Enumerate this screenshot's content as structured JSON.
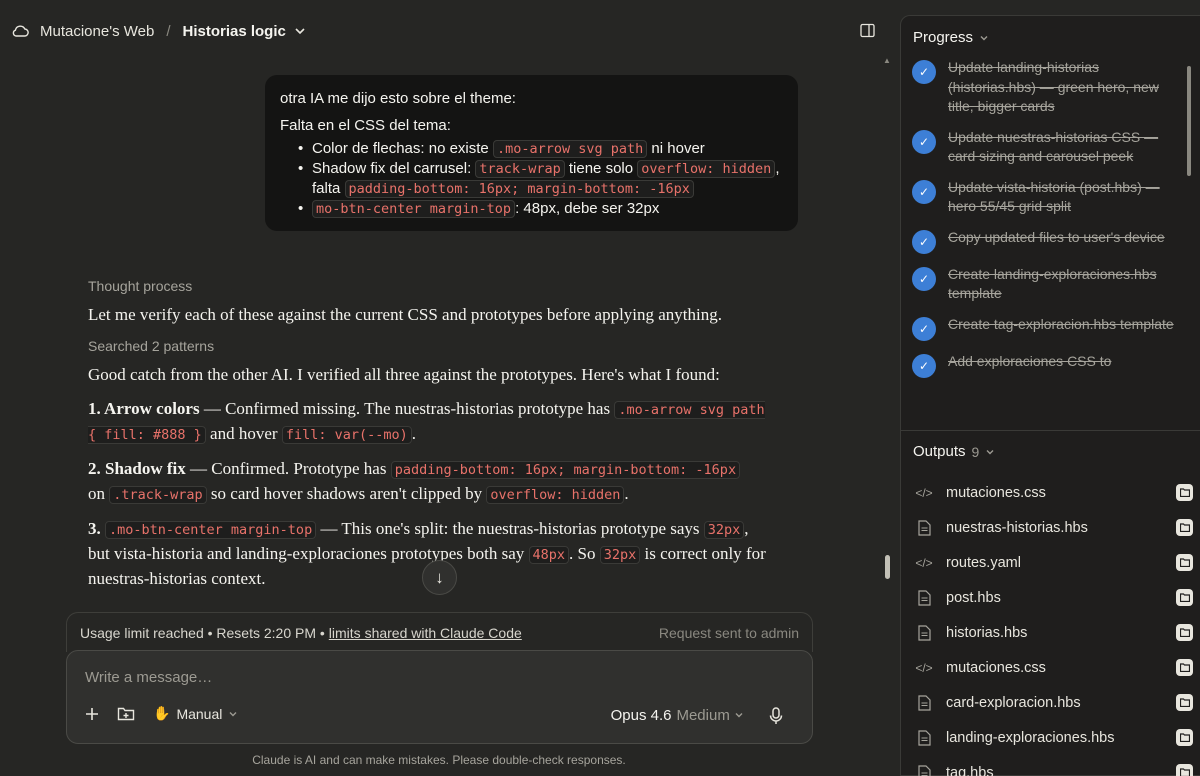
{
  "header": {
    "project": "Mutacione's Web",
    "separator": "/",
    "chat_title": "Historias logic"
  },
  "user_message": {
    "line1": "otra IA me dijo esto sobre el theme:",
    "line2": "Falta en el CSS del tema:",
    "bullet1_pre": "Color de flechas: no existe",
    "bullet1_code": ".mo-arrow svg path",
    "bullet1_post": "ni hover",
    "bullet2_pre": "Shadow fix del carrusel:",
    "bullet2_code1": "track-wrap",
    "bullet2_mid": "tiene solo",
    "bullet2_code2": "overflow: hidden",
    "bullet2_comma": ",",
    "bullet2_falta": "falta",
    "bullet2_code3": "padding-bottom: 16px; margin-bottom: -16px",
    "bullet3_code": "mo-btn-center margin-top",
    "bullet3_post": ": 48px, debe ser 32px"
  },
  "assistant": {
    "thought_label": "Thought process",
    "p1": "Let me verify each of these against the current CSS and prototypes before applying anything.",
    "searched_label": "Searched 2 patterns",
    "p2": "Good catch from the other AI. I verified all three against the prototypes. Here's what I found:",
    "i1_title": "1. Arrow colors",
    "i1_text": " — Confirmed missing. The nuestras-historias prototype has ",
    "i1_code1": ".mo-arrow svg path { fill: #888 }",
    "i1_text2": " and hover ",
    "i1_code2": "fill: var(--mo)",
    "i1_end": ".",
    "i2_title": "2. Shadow fix",
    "i2_text": " — Confirmed. Prototype has ",
    "i2_code1": "padding-bottom: 16px; margin-bottom: -16px",
    "i2_on": "on ",
    "i2_code2": ".track-wrap",
    "i2_text2": " so card hover shadows aren't clipped by ",
    "i2_code3": "overflow: hidden",
    "i2_end": ".",
    "i3_title": "3. ",
    "i3_code1": ".mo-btn-center margin-top",
    "i3_text": " — This one's split: the nuestras-historias prototype says ",
    "i3_code2": "32px",
    "i3_text2": ", but vista-historia and landing-exploraciones prototypes both say ",
    "i3_code3": "48px",
    "i3_text3": ". So ",
    "i3_code4": "32px",
    "i3_text4": " is correct only for nuestras-historias context."
  },
  "usage": {
    "text": "Usage limit reached • Resets 2:20 PM •",
    "link": "limits shared with Claude Code",
    "right": "Request sent to admin"
  },
  "composer": {
    "placeholder": "Write a message…",
    "mode": "Manual",
    "model": "Opus 4.6",
    "effort": "Medium"
  },
  "disclaimer": "Claude is AI and can make mistakes. Please double-check responses.",
  "progress": {
    "title": "Progress",
    "tasks": [
      "Update landing-historias (historias.hbs) — green hero, new title, bigger cards",
      "Update nuestras-historias CSS — card sizing and carousel peek",
      "Update vista-historia (post.hbs) — hero 55/45 grid split",
      "Copy updated files to user's device",
      "Create landing-exploraciones.hbs template",
      "Create tag-exploracion.hbs template",
      "Add exploraciones CSS to"
    ]
  },
  "outputs": {
    "title": "Outputs",
    "count": "9",
    "files": [
      {
        "name": "mutaciones.css",
        "icon": "code-file-icon"
      },
      {
        "name": "nuestras-historias.hbs",
        "icon": "document-icon"
      },
      {
        "name": "routes.yaml",
        "icon": "code-file-icon"
      },
      {
        "name": "post.hbs",
        "icon": "document-icon"
      },
      {
        "name": "historias.hbs",
        "icon": "document-icon"
      },
      {
        "name": "mutaciones.css",
        "icon": "code-file-icon"
      },
      {
        "name": "card-exploracion.hbs",
        "icon": "document-icon"
      },
      {
        "name": "landing-exploraciones.hbs",
        "icon": "document-icon"
      },
      {
        "name": "tag.hbs",
        "icon": "document-icon"
      }
    ]
  },
  "colors": {
    "background": "#262624",
    "panel": "#1f1e1d",
    "accent_blue": "#3d7fd6",
    "code_text": "#e8726a"
  }
}
